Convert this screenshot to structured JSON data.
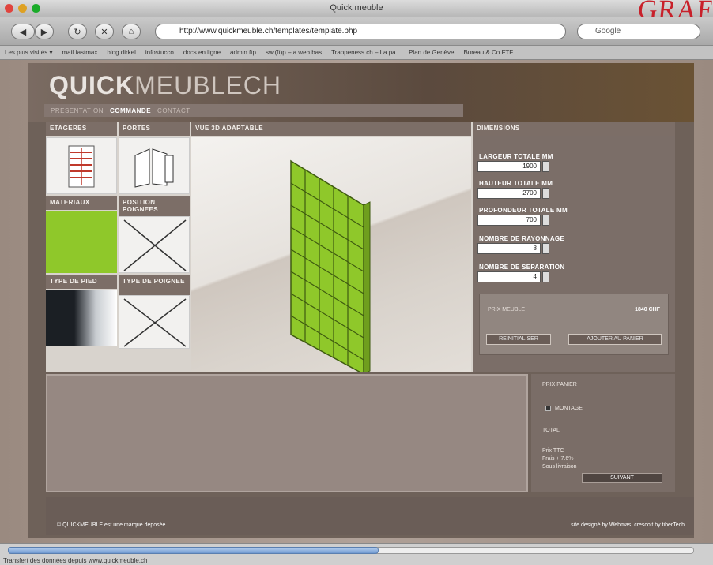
{
  "window": {
    "title": "Quick meuble",
    "graffiti": "GRAF"
  },
  "toolbar": {
    "url": "http://www.quickmeuble.ch/templates/template.php",
    "search_placeholder": "Google"
  },
  "bookmarks": [
    "Les plus visités ▾",
    "mail fastmax",
    "blog dirkel",
    "infostucco",
    "docs en ligne",
    "admin ftp",
    "swi(ft)p – a web bas",
    "Trappeness.ch – La pa..",
    "Plan de Genève",
    "Bureau & Co FTF"
  ],
  "site": {
    "logo_bold": "QUICK",
    "logo_light": "MEUBLECH",
    "nav": [
      {
        "label": "PRESENTATION",
        "active": false
      },
      {
        "label": "COMMANDE",
        "active": true
      },
      {
        "label": "CONTACT",
        "active": false
      }
    ]
  },
  "panels": {
    "etageres": "ETAGERES",
    "portes": "PORTES",
    "vue": "VUE 3D ADAPTABLE",
    "materiaux": "MATERIAUX",
    "position_poignees": "POSITION POIGNEES",
    "type_pied": "TYPE DE PIED",
    "type_poignee": "TYPE DE POIGNEE",
    "dimensions": "DIMENSIONS"
  },
  "form": {
    "largeur_label": "LARGEUR TOTALE MM",
    "largeur_value": "1900",
    "hauteur_label": "HAUTEUR TOTALE MM",
    "hauteur_value": "2700",
    "profondeur_label": "PROFONDEUR TOTALE MM",
    "profondeur_value": "700",
    "rayonnage_label": "NOMBRE DE RAYONNAGE",
    "rayonnage_value": "8",
    "separation_label": "NOMBRE DE SEPARATION",
    "separation_value": "4"
  },
  "price": {
    "label": "PRIX MEUBLE",
    "value": "1840 CHF",
    "reset": "REINITIALISER",
    "add": "AJOUTER AU PANIER"
  },
  "order": {
    "title": "PRIX PANIER",
    "check": "MONTAGE",
    "subtitle": "TOTAL",
    "l1": "Prix TTC",
    "l2": "Frais + 7.6%",
    "l3": "Sous livraison",
    "next": "SUIVANT"
  },
  "footer": {
    "left": "© QUICKMEUBLE est une marque déposée",
    "right": "site designé by Webmas, crescoit by tiberTech"
  },
  "status": {
    "text": "Transfert des données depuis www.quickmeuble.ch",
    "progress": 0.54
  },
  "colors": {
    "accent_green": "#8fc82a",
    "header_brown": "#5b4a3e"
  }
}
